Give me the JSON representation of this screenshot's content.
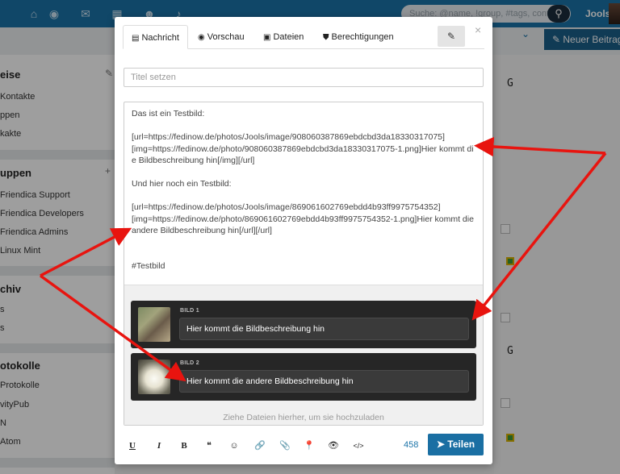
{
  "navbar": {
    "icons": [
      "home-icon",
      "target-icon",
      "envelope-icon",
      "calendar-icon",
      "users-icon",
      "bell-icon"
    ],
    "search_placeholder": "Suche: @name, !group, #tags, content",
    "user_name": "Jools"
  },
  "subbar": {
    "new_post_label": "Neuer Beitrag"
  },
  "sidebar": {
    "section1_title": "eise",
    "section1_items": [
      "Kontakte",
      "ppen",
      "kakte"
    ],
    "section2_title": "uppen",
    "section2_items": [
      "Friendica Support",
      "Friendica Developers",
      "Friendica Admins",
      "Linux Mint"
    ],
    "section3_title": "chiv",
    "section3_items": [
      "s",
      "s"
    ],
    "section4_title": "otokolle",
    "section4_items": [
      "Protokolle",
      "vityPub",
      "N",
      "Atom"
    ]
  },
  "right_col": {
    "letters": [
      "G",
      "G"
    ]
  },
  "modal": {
    "tabs": [
      {
        "label": "Nachricht",
        "icon": "file-icon"
      },
      {
        "label": "Vorschau",
        "icon": "eye-icon"
      },
      {
        "label": "Dateien",
        "icon": "image-icon"
      },
      {
        "label": "Berechtigungen",
        "icon": "shield-icon"
      }
    ],
    "close_label": "×",
    "title_placeholder": "Titel setzen",
    "body_text": "Das ist ein Testbild:\n\n[url=https://fedinow.de/photos/Jools/image/908060387869ebdcbd3da18330317075]\n[img=https://fedinow.de/photo/908060387869ebdcbd3da18330317075-1.png]Hier kommt die Bildbeschreibung hin[/img][/url]\n\nUnd hier noch ein Testbild:\n\n[url=https://fedinow.de/photos/Jools/image/869061602769ebdd4b93ff9975754352]\n[img=https://fedinow.de/photo/869061602769ebdd4b93ff9975754352-1.png]Hier kommt die andere Bildbeschreibung hin[/url][/url]\n\n\n#Testbild",
    "attachments": [
      {
        "label": "BILD 1",
        "description": "Hier kommt die Bildbeschreibung hin"
      },
      {
        "label": "BILD 2",
        "description": "Hier kommt die andere Bildbeschreibung hin"
      }
    ],
    "drop_hint": "Ziehe Dateien hierher, um sie hochzuladen",
    "toolbar": {
      "buttons": [
        "underline-icon",
        "italic-icon",
        "bold-icon",
        "quote-icon",
        "smiley-icon",
        "link-icon",
        "attach-icon",
        "location-icon",
        "eye-icon",
        "code-icon"
      ],
      "glyphs": [
        "U",
        "I",
        "B",
        "❝",
        "☺",
        "🔗",
        "📎",
        "📍",
        "👁",
        "</>"
      ],
      "char_count": "458",
      "share_label": "Teilen"
    }
  },
  "colors": {
    "navbar": "#1a73a8",
    "share_button": "#1a6fa3",
    "arrow": "#e8140f",
    "card_bg": "#262626"
  }
}
